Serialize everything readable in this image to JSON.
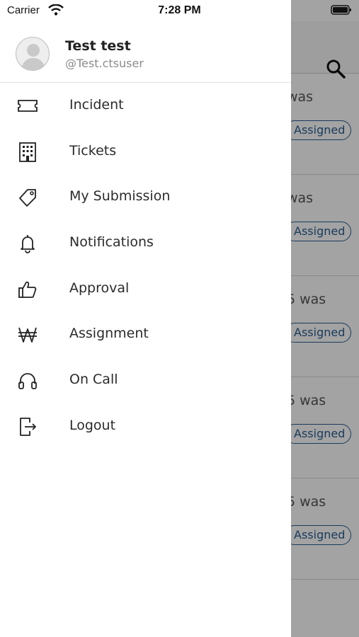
{
  "status_bar": {
    "carrier": "Carrier",
    "time": "7:28 PM"
  },
  "drawer": {
    "user": {
      "name": "Test test",
      "handle": "@Test.ctsuser"
    },
    "items": [
      {
        "label": "Incident",
        "icon": "ticket-icon"
      },
      {
        "label": "Tickets",
        "icon": "building-icon"
      },
      {
        "label": "My Submission",
        "icon": "tag-icon"
      },
      {
        "label": "Notifications",
        "icon": "bell-icon"
      },
      {
        "label": "Approval",
        "icon": "thumbs-up-icon"
      },
      {
        "label": "Assignment",
        "icon": "won-icon"
      },
      {
        "label": "On Call",
        "icon": "headphones-icon"
      },
      {
        "label": "Logout",
        "icon": "logout-icon"
      }
    ]
  },
  "background": {
    "cards": [
      {
        "text": "was",
        "badge": "Assigned"
      },
      {
        "text": "was",
        "badge": "Assigned"
      },
      {
        "text": "5 was",
        "badge": "Assigned"
      },
      {
        "text": "5 was",
        "badge": "Assigned"
      },
      {
        "text": "5 was",
        "badge": "Assigned"
      }
    ]
  },
  "colors": {
    "badge": "#2a5d8f",
    "dim_overlay": "rgba(0,0,0,0.36)"
  }
}
